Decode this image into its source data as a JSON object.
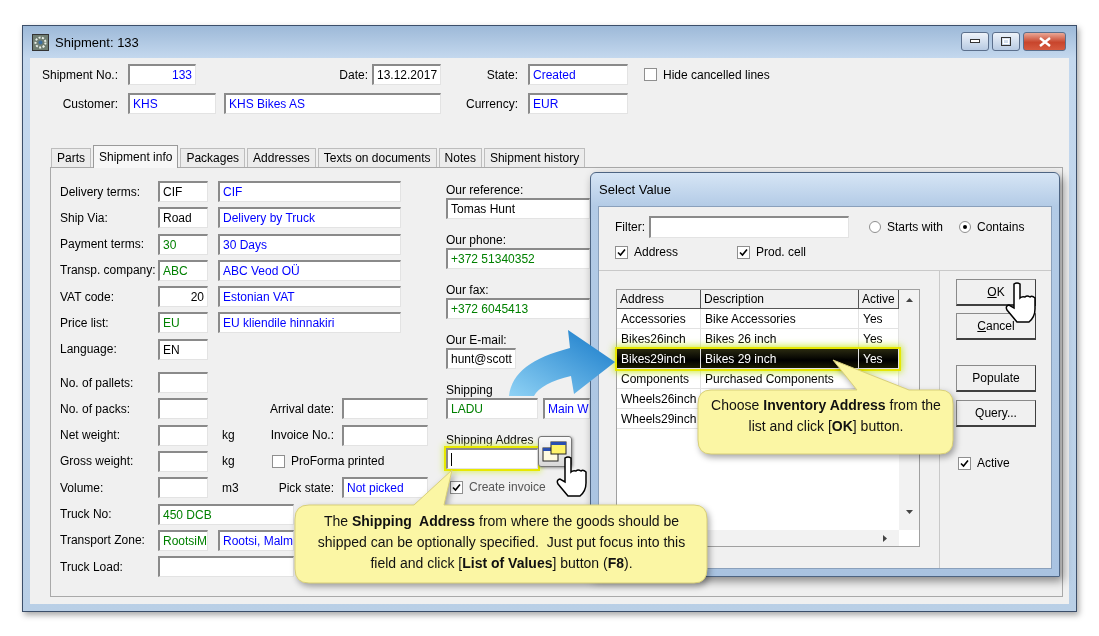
{
  "window": {
    "title": "Shipment: 133"
  },
  "header": {
    "shipment_no": {
      "label": "Shipment No.:",
      "value": "133",
      "color": "#0000ff",
      "numeric": true
    },
    "date": {
      "label": "Date:",
      "value": "13.12.2017",
      "color": "#000000"
    },
    "state": {
      "label": "State:",
      "value": "Created",
      "color": "#0000ff"
    },
    "hide_cancelled": {
      "label": "Hide cancelled lines",
      "checked": false
    },
    "customer": {
      "label": "Customer:",
      "code": {
        "value": "KHS",
        "color": "#0000ff"
      },
      "name": {
        "value": "KHS Bikes AS",
        "color": "#0000ff"
      }
    },
    "currency": {
      "label": "Currency:",
      "value": "EUR",
      "color": "#0000ff"
    }
  },
  "tabs": [
    {
      "label": "Parts",
      "selected": false
    },
    {
      "label": "Shipment info",
      "selected": true
    },
    {
      "label": "Packages",
      "selected": false
    },
    {
      "label": "Addresses",
      "selected": false
    },
    {
      "label": "Texts on documents",
      "selected": false
    },
    {
      "label": "Notes",
      "selected": false
    },
    {
      "label": "Shipment history",
      "selected": false
    }
  ],
  "shipment_info": {
    "terms": [
      {
        "label": "Delivery terms:",
        "code": {
          "value": "CIF",
          "color": "#000000"
        },
        "description": {
          "value": "CIF",
          "color": "#0000ff"
        }
      },
      {
        "label": "Ship Via:",
        "code": {
          "value": "Road",
          "color": "#000000"
        },
        "description": {
          "value": "Delivery by Truck",
          "color": "#0000ff"
        }
      },
      {
        "label": "Payment terms:",
        "code": {
          "value": "30",
          "color": "#008000"
        },
        "description": {
          "value": "30 Days",
          "color": "#0000ff"
        }
      },
      {
        "label": "Transp. company:",
        "code": {
          "value": "ABC",
          "color": "#008000"
        },
        "description": {
          "value": "ABC Veod OÜ",
          "color": "#0000ff"
        }
      },
      {
        "label": "VAT code:",
        "code": {
          "value": "20",
          "color": "#000000",
          "numeric": true
        },
        "description": {
          "value": "Estonian VAT",
          "color": "#0000ff"
        }
      },
      {
        "label": "Price list:",
        "code": {
          "value": "EU",
          "color": "#008000"
        },
        "description": {
          "value": "EU kliendile hinnakiri",
          "color": "#0000ff"
        }
      },
      {
        "label": "Language:",
        "code": {
          "value": "EN",
          "color": "#000000"
        }
      }
    ],
    "measures": [
      {
        "label": "No. of pallets:"
      },
      {
        "label": "No. of packs:",
        "side": {
          "kind": "field",
          "label": "Arrival date:"
        }
      },
      {
        "label": "Net weight:",
        "unit": "kg",
        "side": {
          "kind": "field",
          "label": "Invoice No.:"
        }
      },
      {
        "label": "Gross weight:",
        "unit": "kg",
        "side": {
          "kind": "checkbox",
          "label": "ProForma printed",
          "checked": false
        }
      },
      {
        "label": "Volume:",
        "unit": "m3",
        "side": {
          "kind": "field",
          "label": "Pick state:",
          "value": "Not picked",
          "color": "#0000ff"
        }
      }
    ],
    "transport": [
      {
        "label": "Truck No:",
        "kind": "wide",
        "value": "450 DCB",
        "color": "#008000"
      },
      {
        "label": "Transport Zone:",
        "kind": "pair",
        "code": {
          "value": "RootsiM",
          "color": "#008000"
        },
        "description": {
          "value": "Rootsi, Malm",
          "color": "#0000ff"
        }
      },
      {
        "label": "Truck Load:",
        "kind": "wide"
      }
    ],
    "contact": [
      {
        "label": "Our reference:",
        "value": "Tomas Hunt",
        "color": "#000000"
      },
      {
        "label": "Our phone:",
        "value": "+372 51340352",
        "color": "#008000"
      },
      {
        "label": "Our fax:",
        "value": "+372 6045413",
        "color": "#008000"
      },
      {
        "label": "Our E-mail:",
        "value": "hunt@scott",
        "color": "#000000"
      }
    ],
    "shipping": {
      "label": "Shipping",
      "code": {
        "value": "LADU",
        "color": "#008000"
      },
      "name": {
        "value": "Main W",
        "color": "#0000ff"
      }
    },
    "shipping_address": {
      "label": "Shipping Addres",
      "focused": true
    },
    "create_invoice": {
      "label": "Create invoice",
      "checked": true
    }
  },
  "dialog": {
    "title": "Select Value",
    "filter": {
      "label": "Filter:"
    },
    "match": [
      {
        "label": "Starts with",
        "selected": false
      },
      {
        "label": "Contains",
        "selected": true
      }
    ],
    "toggles": [
      {
        "label": "Address",
        "checked": true
      },
      {
        "label": "Prod. cell",
        "checked": true
      }
    ],
    "table": {
      "columns": [
        "Address",
        "Description",
        "Active"
      ],
      "rows": [
        {
          "cells": [
            "Accessories",
            "Bike Accessories",
            "Yes"
          ],
          "selected": false
        },
        {
          "cells": [
            "Bikes26inch",
            "Bikes 26 inch",
            "Yes"
          ],
          "selected": false
        },
        {
          "cells": [
            "Bikes29inch",
            "Bikes 29 inch",
            "Yes"
          ],
          "selected": true
        },
        {
          "cells": [
            "Components",
            "Purchased Components"
          ],
          "selected": false
        },
        {
          "cells": [
            "Wheels26inch"
          ],
          "selected": false
        },
        {
          "cells": [
            "Wheels29inch"
          ],
          "selected": false
        }
      ]
    },
    "buttons": [
      {
        "label": "OK",
        "mnemonic": true
      },
      {
        "label": "Cancel",
        "mnemonic": true
      },
      {
        "label": "Populate",
        "mnemonic": false
      },
      {
        "label": "Query...",
        "mnemonic": false
      }
    ],
    "active": {
      "label": "Active",
      "checked": true
    }
  },
  "callouts": [
    {
      "kind": "pick",
      "text": "Choose **Inventory Address** from the list and click [**OK**] button."
    },
    {
      "kind": "ship",
      "text": "The **Shipping  Address** from where the goods should be shipped can be optionally specified.  Just put focus into this field and click [**List of Values**] button (**F8**)."
    }
  ]
}
